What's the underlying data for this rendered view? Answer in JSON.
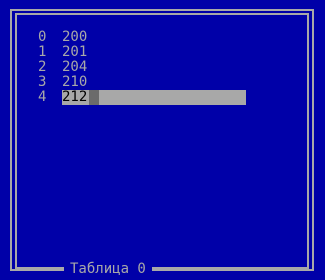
{
  "title": "Таблица 0",
  "rows": [
    {
      "index": "0",
      "value": "200"
    },
    {
      "index": "1",
      "value": "201"
    },
    {
      "index": "2",
      "value": "204"
    },
    {
      "index": "3",
      "value": "210"
    },
    {
      "index": "4",
      "value": "212"
    }
  ],
  "selected_row": 4,
  "colors": {
    "background": "#0000a8",
    "text": "#a8a8a8",
    "selection": "#a8a8a8",
    "cursor": "#6b6b6b"
  }
}
